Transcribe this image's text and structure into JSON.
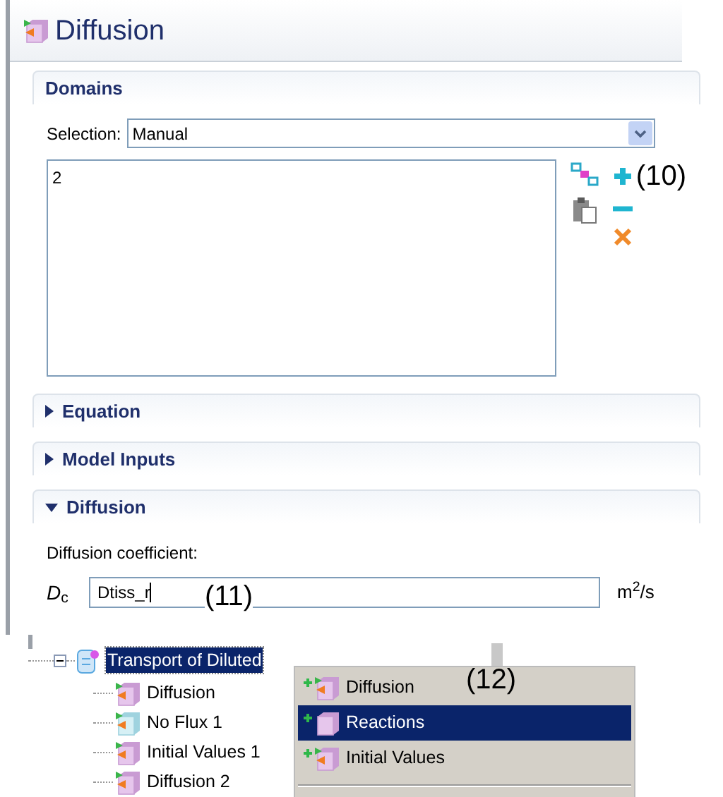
{
  "title": "Diffusion",
  "domains": {
    "title": "Domains",
    "selection_label": "Selection:",
    "selection_value": "Manual",
    "list_items": [
      "2"
    ],
    "annotation": "(10)"
  },
  "sections": [
    {
      "title": "Equation",
      "expanded": false
    },
    {
      "title": "Model Inputs",
      "expanded": false
    },
    {
      "title": "Diffusion",
      "expanded": true
    }
  ],
  "coefficient": {
    "label": "Diffusion coefficient:",
    "symbol": "*D*$_{c}$",
    "value": "Dtiss_r",
    "annotation": "(11)",
    "unit": "m$^{2}$/s"
  },
  "tree": {
    "label": "Transport of Diluted",
    "selected": true,
    "expanded": true,
    "children": [
      {
        "label": "Diffusion",
        "kind": "domain"
      },
      {
        "label": "No Flux 1",
        "kind": "boundary"
      },
      {
        "label": "Initial Values 1",
        "kind": "domain"
      },
      {
        "label": "Diffusion 2",
        "kind": "domain"
      }
    ]
  },
  "context_menu": {
    "annotation": "(12)",
    "items": [
      {
        "label": "Diffusion",
        "selected": false,
        "kind": "arrows"
      },
      {
        "label": "Reactions",
        "selected": true,
        "kind": "plain"
      },
      {
        "label": "Initial Values",
        "selected": false,
        "kind": "arrows"
      }
    ]
  }
}
